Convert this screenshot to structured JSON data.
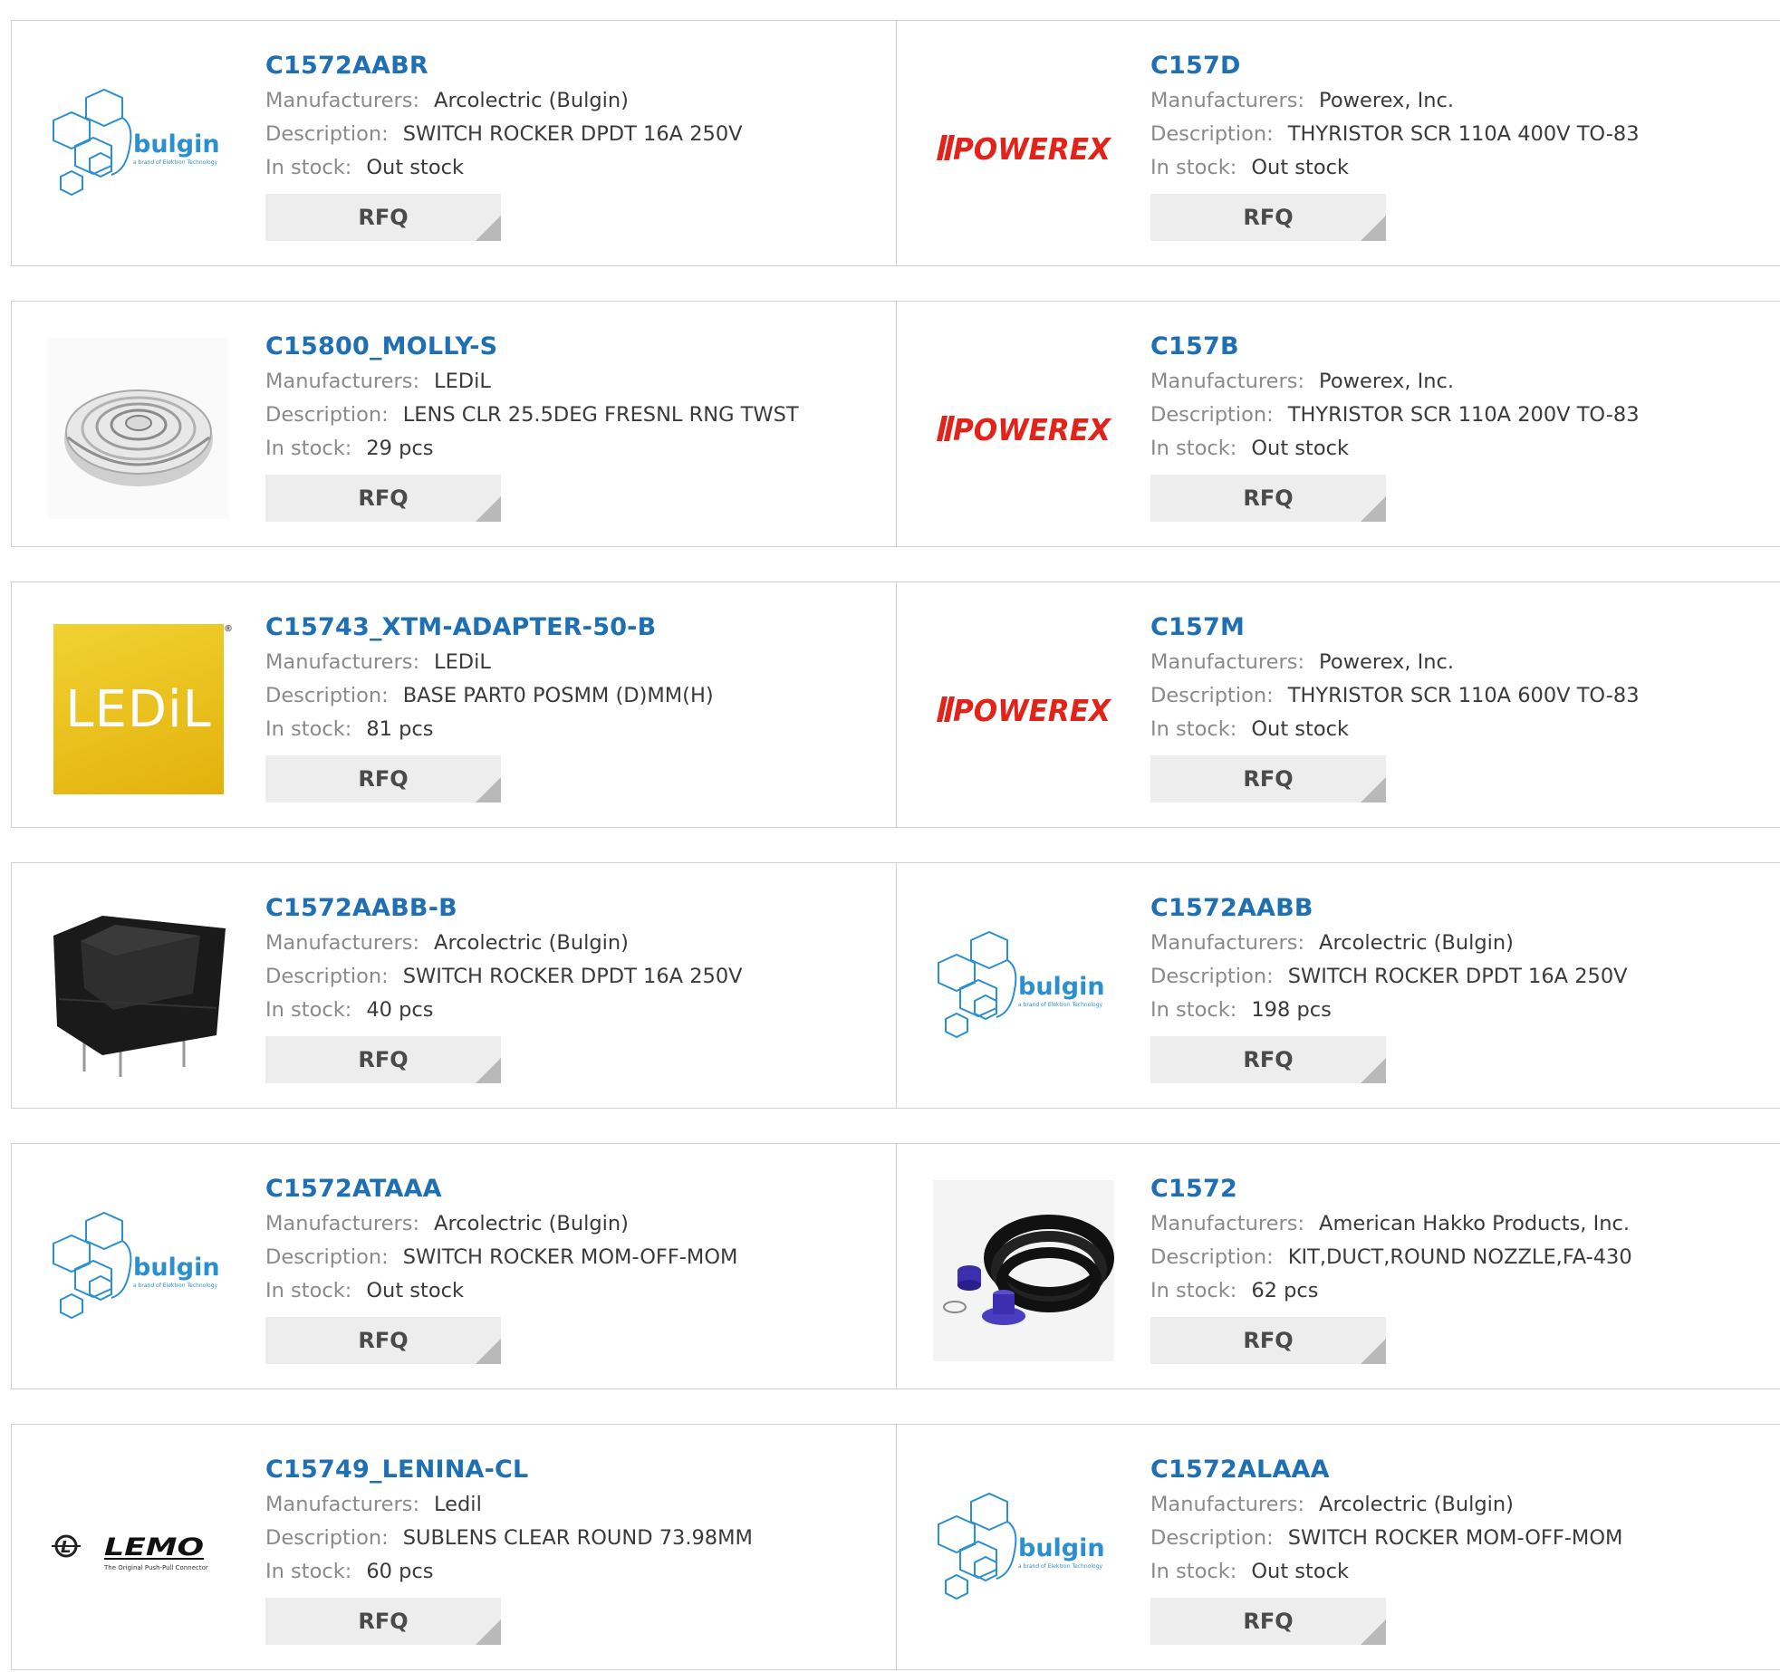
{
  "labels": {
    "manufacturers": "Manufacturers:",
    "description": "Description:",
    "in_stock": "In stock:",
    "rfq": "RFQ"
  },
  "brand_text": {
    "bulgin": "bulgin",
    "bulgin_tag": "a brand of Elektron Technology",
    "powerex": "POWEREX",
    "ledil": "LEDiL",
    "lemo": "LEMO",
    "lemo_tag": "The Original Push-Pull Connector"
  },
  "colors": {
    "link": "#1f6fb5",
    "border": "#cfcfcf",
    "button": "#ededed",
    "bulgin_blue": "#2c8fd0",
    "powerex_red": "#e2231a"
  },
  "products": [
    {
      "part": "C1572AABR",
      "manufacturer": "Arcolectric (Bulgin)",
      "description": "SWITCH ROCKER DPDT 16A 250V",
      "stock": "Out stock",
      "image": "bulgin-logo"
    },
    {
      "part": "C157D",
      "manufacturer": "Powerex, Inc.",
      "description": "THYRISTOR SCR 110A 400V TO-83",
      "stock": "Out stock",
      "image": "powerex-logo"
    },
    {
      "part": "C15800_MOLLY-S",
      "manufacturer": "LEDiL",
      "description": "LENS CLR 25.5DEG FRESNL RNG TWST",
      "stock": "29 pcs",
      "image": "lens-photo"
    },
    {
      "part": "C157B",
      "manufacturer": "Powerex, Inc.",
      "description": "THYRISTOR SCR 110A 200V TO-83",
      "stock": "Out stock",
      "image": "powerex-logo"
    },
    {
      "part": "C15743_XTM-ADAPTER-50-B",
      "manufacturer": "LEDiL",
      "description": "BASE PART0 POSMM (D)MM(H)",
      "stock": "81 pcs",
      "image": "ledil-logo"
    },
    {
      "part": "C157M",
      "manufacturer": "Powerex, Inc.",
      "description": "THYRISTOR SCR 110A 600V TO-83",
      "stock": "Out stock",
      "image": "powerex-logo"
    },
    {
      "part": "C1572AABB-B",
      "manufacturer": "Arcolectric (Bulgin)",
      "description": "SWITCH ROCKER DPDT 16A 250V",
      "stock": "40 pcs",
      "image": "rocker-switch-photo"
    },
    {
      "part": "C1572AABB",
      "manufacturer": "Arcolectric (Bulgin)",
      "description": "SWITCH ROCKER DPDT 16A 250V",
      "stock": "198 pcs",
      "image": "bulgin-logo"
    },
    {
      "part": "C1572ATAAA",
      "manufacturer": "Arcolectric (Bulgin)",
      "description": "SWITCH ROCKER MOM-OFF-MOM",
      "stock": "Out stock",
      "image": "bulgin-logo"
    },
    {
      "part": "C1572",
      "manufacturer": "American Hakko Products, Inc.",
      "description": "KIT,DUCT,ROUND NOZZLE,FA-430",
      "stock": "62 pcs",
      "image": "duct-kit-photo"
    },
    {
      "part": "C15749_LENINA-CL",
      "manufacturer": "Ledil",
      "description": "SUBLENS CLEAR ROUND 73.98MM",
      "stock": "60 pcs",
      "image": "lemo-logo"
    },
    {
      "part": "C1572ALAAA",
      "manufacturer": "Arcolectric (Bulgin)",
      "description": "SWITCH ROCKER MOM-OFF-MOM",
      "stock": "Out stock",
      "image": "bulgin-logo"
    }
  ]
}
